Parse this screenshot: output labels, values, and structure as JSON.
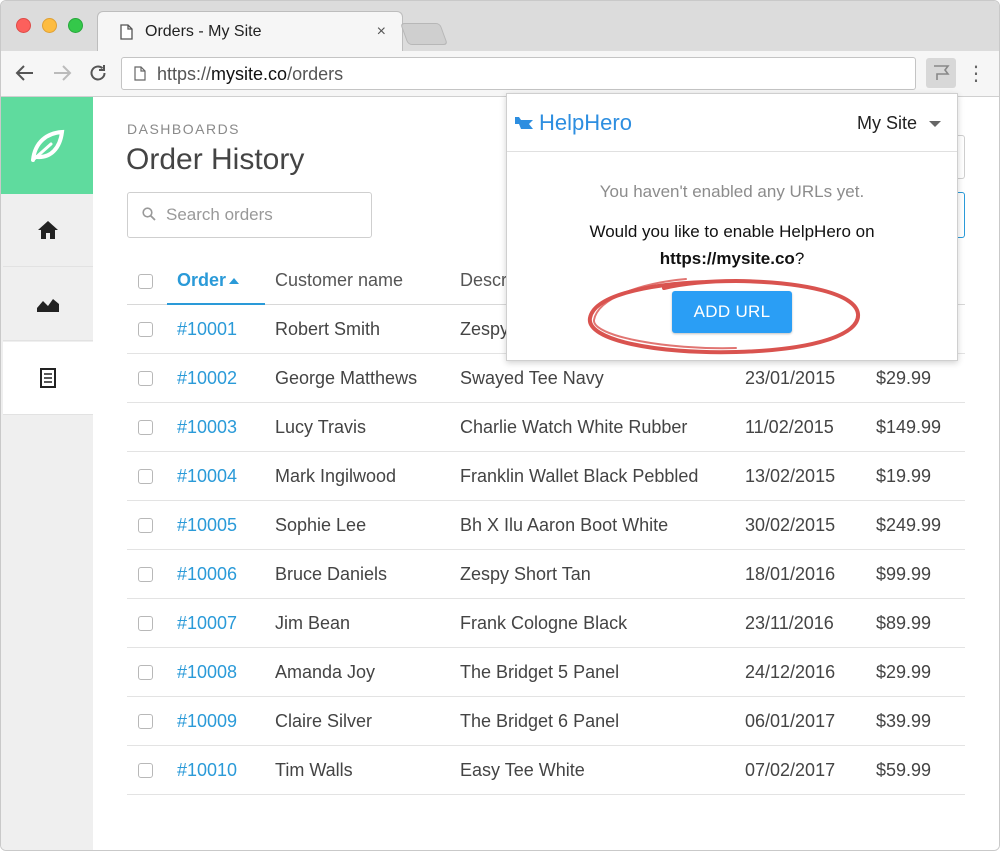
{
  "browser": {
    "tab_title": "Orders - My Site",
    "tab_close": "×",
    "address_scheme": "https://",
    "address_host": "mysite.co",
    "address_path": "/orders",
    "menu_glyph": "⋮"
  },
  "sidebar": {
    "items": [
      {
        "icon": "leaf-icon"
      },
      {
        "icon": "home-icon"
      },
      {
        "icon": "area-chart-icon"
      },
      {
        "icon": "document-icon"
      }
    ],
    "brand_color": "#5fdb9e"
  },
  "page": {
    "breadcrumb": "DASHBOARDS",
    "title": "Order History",
    "search_placeholder": "Search orders"
  },
  "table": {
    "headers": {
      "order": "Order",
      "customer": "Customer name",
      "description": "Descr"
    },
    "rows": [
      {
        "order": "#10001",
        "customer": "Robert Smith",
        "description": "Zespy",
        "date": "",
        "price": ""
      },
      {
        "order": "#10002",
        "customer": "George Matthews",
        "description": "Swayed Tee Navy",
        "date": "23/01/2015",
        "price": "$29.99"
      },
      {
        "order": "#10003",
        "customer": "Lucy Travis",
        "description": "Charlie Watch White Rubber",
        "date": "11/02/2015",
        "price": "$149.99"
      },
      {
        "order": "#10004",
        "customer": "Mark Ingilwood",
        "description": "Franklin Wallet Black Pebbled",
        "date": "13/02/2015",
        "price": "$19.99"
      },
      {
        "order": "#10005",
        "customer": "Sophie Lee",
        "description": "Bh X Ilu Aaron Boot White",
        "date": "30/02/2015",
        "price": "$249.99"
      },
      {
        "order": "#10006",
        "customer": "Bruce Daniels",
        "description": "Zespy Short Tan",
        "date": "18/01/2016",
        "price": "$99.99"
      },
      {
        "order": "#10007",
        "customer": "Jim Bean",
        "description": "Frank Cologne Black",
        "date": "23/11/2016",
        "price": "$89.99"
      },
      {
        "order": "#10008",
        "customer": "Amanda Joy",
        "description": "The Bridget 5 Panel",
        "date": "24/12/2016",
        "price": "$29.99"
      },
      {
        "order": "#10009",
        "customer": "Claire Silver",
        "description": "The Bridget 6 Panel",
        "date": "06/01/2017",
        "price": "$39.99"
      },
      {
        "order": "#10010",
        "customer": "Tim Walls",
        "description": "Easy Tee White",
        "date": "07/02/2017",
        "price": "$59.99"
      }
    ],
    "accent_color": "#2a9ad8"
  },
  "popup": {
    "brand": "HelpHero",
    "site_selector": "My Site",
    "note": "You haven't enabled any URLs yet.",
    "question": "Would you like to enable HelpHero on",
    "url": "https://mysite.co",
    "url_suffix": "?",
    "button_label": "ADD URL",
    "button_color": "#2a9ef5",
    "highlight_color": "#d9534f"
  }
}
